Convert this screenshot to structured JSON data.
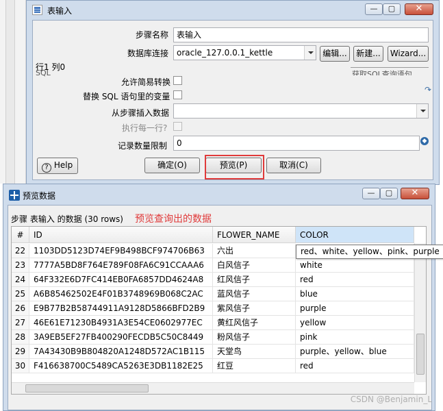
{
  "input_dialog": {
    "title": "表输入",
    "step_name_label": "步骤名称",
    "step_name_value": "表输入",
    "db_conn_label": "数据库连接",
    "db_conn_value": "oracle_127.0.0.1_kettle",
    "edit_label": "编辑...",
    "new_label": "新建...",
    "wizard_label": "Wizard...",
    "cursor_pos": "行1 列0",
    "sql_label": "SQL",
    "sql_hint": "获取SQL查询语句",
    "lazy_label": "允许简易转换",
    "replace_vars_label": "替换 SQL 语句里的变量",
    "insert_from_step_label": "从步骤插入数据",
    "insert_from_step_value": "",
    "exec_each_row_label": "执行每一行?",
    "limit_label": "记录数量限制",
    "limit_value": "0",
    "help_label": "Help",
    "ok_label": "确定(O)",
    "preview_label": "预览(P)",
    "cancel_label": "取消(C)"
  },
  "preview_dialog": {
    "title": "预览数据",
    "caption": "步骤 表输入 的数据 (30 rows)",
    "annotation": "预览查询出的数据",
    "annotation_color": "#e03a3a",
    "columns": [
      "#",
      "ID",
      "FLOWER_NAME",
      "COLOR"
    ],
    "rows": [
      {
        "num": "22",
        "id": "1103DD5123D74EF9B498BCF974706B63",
        "name": "六出",
        "color": ""
      },
      {
        "num": "23",
        "id": "7777A5BD8F764E789F08FA6C91CCAAA6",
        "name": "白风信子",
        "color": "white"
      },
      {
        "num": "24",
        "id": "64F332E6D7FC414EB0FA6857DD4624A8",
        "name": "红风信子",
        "color": "red"
      },
      {
        "num": "25",
        "id": "A6B85462502E4F01B3748969B068C2AC",
        "name": "蓝风信子",
        "color": "blue"
      },
      {
        "num": "26",
        "id": "E9B77B2B58744911A9128D5866BFD2B9",
        "name": "紫风信子",
        "color": "purple"
      },
      {
        "num": "27",
        "id": "46E61E71230B4931A3E54CE0602977EC",
        "name": "黄红风信子",
        "color": "yellow"
      },
      {
        "num": "28",
        "id": "3A9EB5EF27FB400290FECDB5C50C8449",
        "name": "粉风信子",
        "color": "pink"
      },
      {
        "num": "29",
        "id": "7A43430B9B804820A1248D572AC1B115",
        "name": "天堂鸟",
        "color": "purple、yellow、blue"
      },
      {
        "num": "30",
        "id": "F416638700C5489CA5263E3DB1182E25",
        "name": "红豆",
        "color": "red"
      }
    ],
    "tooltip": "red、white、yellow、pink、purple"
  },
  "watermark": "CSDN @Benjamin_L",
  "icons": {
    "help": "help-icon",
    "app": "kettle-icon",
    "minimize": "minimize-icon",
    "maximize": "maximize-icon",
    "close": "close-icon"
  }
}
